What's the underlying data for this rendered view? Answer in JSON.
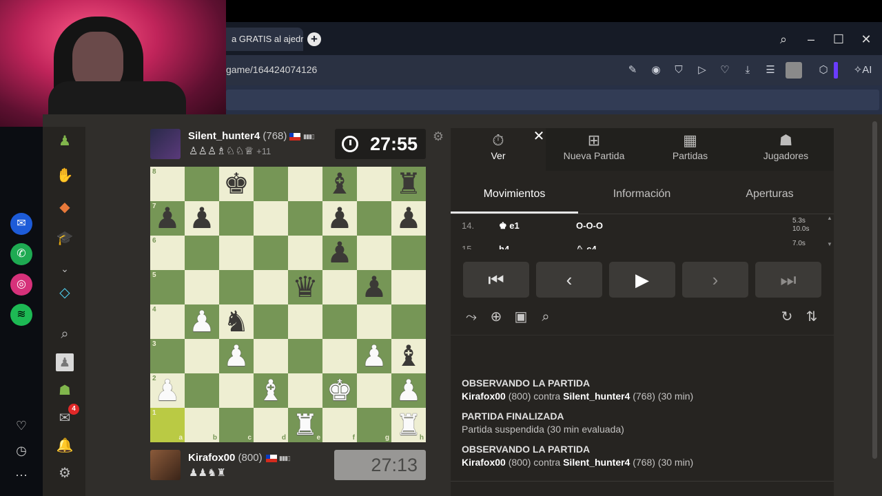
{
  "browser": {
    "tab_title": "a GRATIS al ajedre",
    "new_tab": "+",
    "url": "game/164424074126",
    "ai_label": "AI",
    "window_controls": [
      "minimize",
      "maximize",
      "close"
    ]
  },
  "top_player": {
    "name": "Silent_hunter4",
    "rating": "(768)",
    "captured": "♙♙♙♗♘♘♕",
    "advantage": "+11",
    "clock": "27:55"
  },
  "bottom_player": {
    "name": "Kirafox00",
    "rating": "(800)",
    "captured": "♟♟♞♜",
    "clock": "27:13"
  },
  "board": {
    "files": [
      "a",
      "b",
      "c",
      "d",
      "e",
      "f",
      "g",
      "h"
    ],
    "ranks": [
      "8",
      "7",
      "6",
      "5",
      "4",
      "3",
      "2",
      "1"
    ],
    "pieces": {
      "c8": "bk",
      "f8": "bb",
      "h8": "br",
      "a7": "bp",
      "b7": "bp",
      "f7": "bp",
      "h7": "bp",
      "f6": "bp",
      "e5": "bq",
      "g5": "bp",
      "b4": "wp",
      "c4": "bn",
      "c3": "wp",
      "g3": "wp",
      "h3": "bb",
      "a2": "wp",
      "d2": "wb",
      "f2": "wk",
      "h2": "wp",
      "e1": "wr",
      "h1": "wr"
    },
    "highlighted": [
      "a1"
    ],
    "colors": {
      "light": "#eeeed2",
      "dark": "#769656",
      "highlight": "#baca44"
    }
  },
  "panel": {
    "tabs": [
      {
        "label": "Ver",
        "icon": "stopwatch-icon"
      },
      {
        "label": "Nueva Partida",
        "icon": "plus-icon"
      },
      {
        "label": "Partidas",
        "icon": "board-icon"
      },
      {
        "label": "Jugadores",
        "icon": "users-icon"
      }
    ],
    "subtabs": [
      "Movimientos",
      "Información",
      "Aperturas"
    ],
    "moves": [
      {
        "num": "14.",
        "white": "♚ e1",
        "black": "O-O-O",
        "times": [
          "5.3s",
          "10.0s"
        ]
      },
      {
        "num": "15.",
        "white": "h4",
        "black": "♘ c4",
        "times": [
          "7.0s"
        ]
      }
    ],
    "chat": [
      {
        "header": "OBSERVANDO LA PARTIDA",
        "p1": "Kirafox00",
        "p1r": "(800)",
        "vs": "contra",
        "p2": "Silent_hunter4",
        "p2r": "(768)",
        "mode": "(30 min)"
      },
      {
        "header": "PARTIDA FINALIZADA",
        "text": "Partida suspendida (30 min evaluada)"
      },
      {
        "header": "OBSERVANDO LA PARTIDA",
        "p1": "Kirafox00",
        "p1r": "(800)",
        "vs": "contra",
        "p2": "Silent_hunter4",
        "p2r": "(768)",
        "mode": "(30 min)"
      }
    ]
  },
  "sidebar": {
    "mail_badge": "4"
  }
}
